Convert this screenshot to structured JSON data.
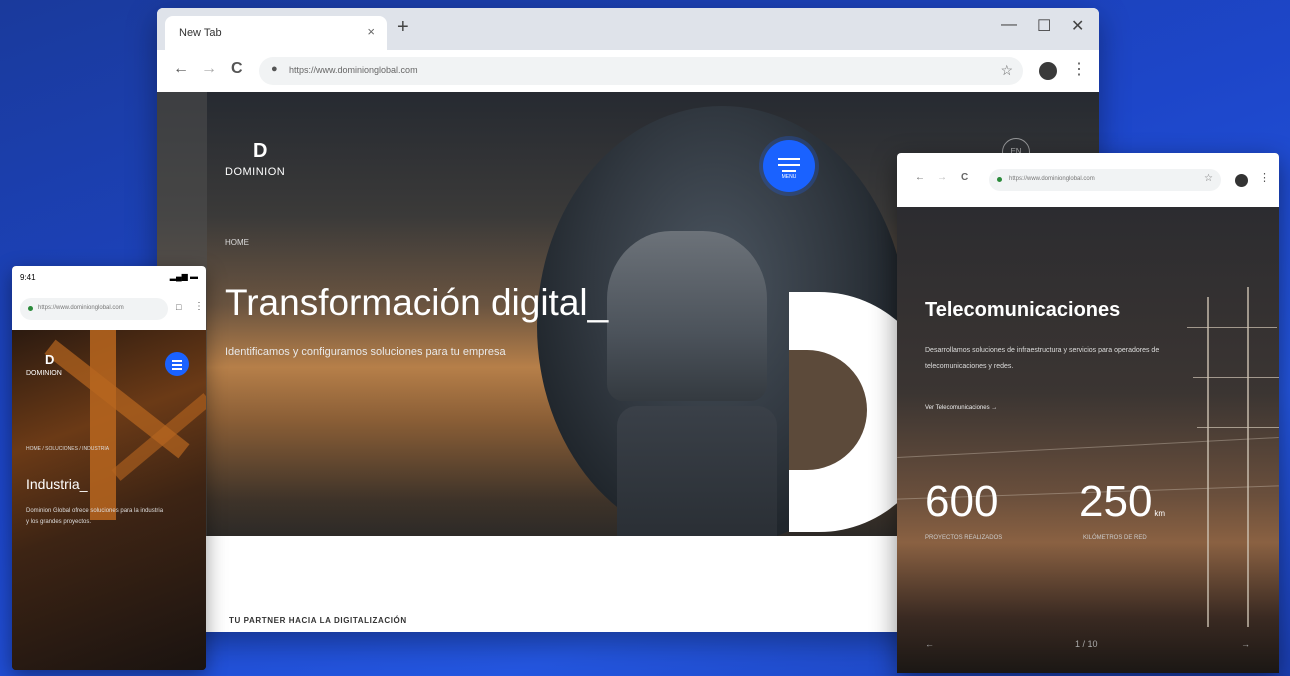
{
  "main_browser": {
    "tab_title": "New Tab",
    "url": "https://www.dominionglobal.com",
    "hero": {
      "logo_mark": "D",
      "logo_text": "DOMINION",
      "menu_label": "MENU",
      "breadcrumb": "HOME",
      "title": "Transformación digital_",
      "subtitle": "Identificamos y configuramos soluciones para tu empresa",
      "side_button": "EN"
    },
    "below_title": "TU PARTNER HACIA LA DIGITALIZACIÓN"
  },
  "mobile": {
    "time": "9:41",
    "signal": "▂▄▆ ▬",
    "url": "https://www.dominionglobal.com",
    "logo_mark": "D",
    "logo_text": "DOMINION",
    "breadcrumb": "HOME / SOLUCIONES / INDUSTRIA",
    "title": "Industria_",
    "description": "Dominion Global ofrece soluciones para la industria y los grandes proyectos."
  },
  "tablet": {
    "url": "https://www.dominionglobal.com",
    "title": "Telecomunicaciones",
    "description": "Desarrollamos soluciones de infraestructura y servicios para operadores de telecomunicaciones y redes.",
    "link": "Ver Telecomunicaciones  →",
    "stat1": {
      "value": "600",
      "label": "PROYECTOS REALIZADOS"
    },
    "stat2": {
      "value": "250",
      "unit": "km",
      "label": "KILÓMETROS DE RED"
    },
    "pager": "1 / 10",
    "prev": "←",
    "next": "→"
  },
  "icons": {
    "back": "←",
    "forward": "→",
    "reload": "C",
    "star": "☆",
    "kebab": "⋮",
    "close": "×",
    "plus": "+",
    "minimize": "—",
    "maximize": "☐",
    "window_close": "✕",
    "lock": "🔒"
  },
  "colors": {
    "accent": "#1a62ff",
    "background": "#1d46c9"
  }
}
